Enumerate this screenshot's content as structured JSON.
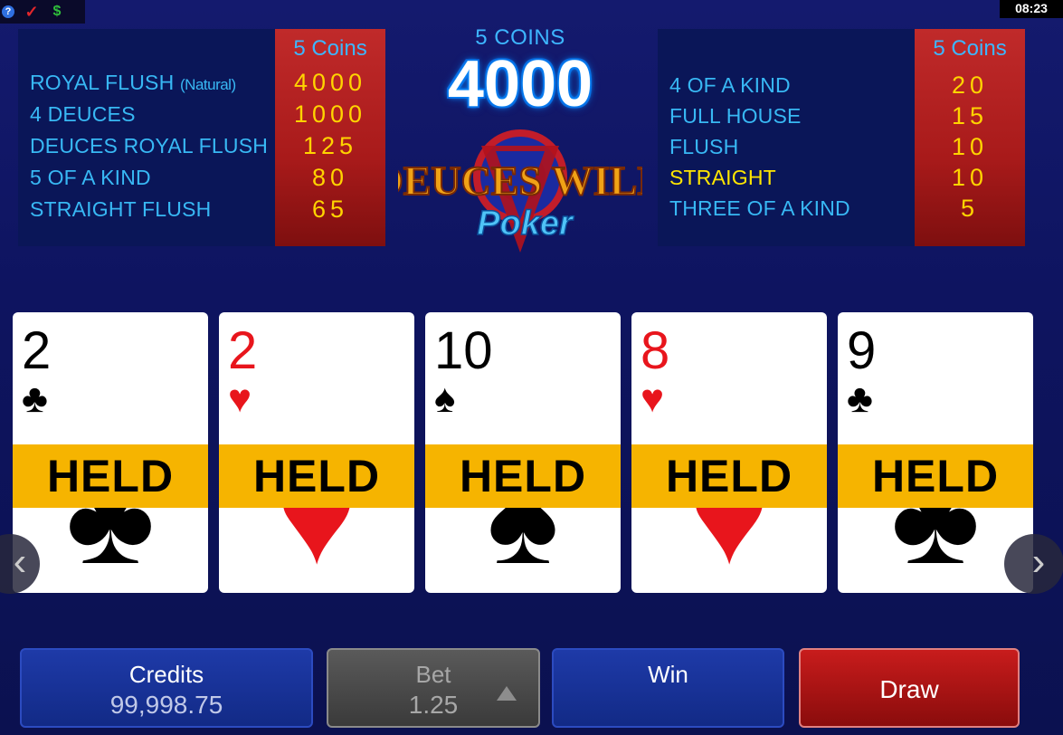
{
  "top_bar": {
    "help_icon_glyph": "?",
    "check_icon_glyph": "✓",
    "dollar_icon_glyph": "$",
    "clock": "08:23"
  },
  "paytable_left": {
    "header": "5 Coins",
    "rows": [
      {
        "name": "ROYAL FLUSH",
        "sub": "(Natural)",
        "value": "4000"
      },
      {
        "name": "4 DEUCES",
        "sub": "",
        "value": "1000"
      },
      {
        "name": "DEUCES ROYAL FLUSH",
        "sub": "",
        "value": "125"
      },
      {
        "name": "5 OF A KIND",
        "sub": "",
        "value": "80"
      },
      {
        "name": "STRAIGHT FLUSH",
        "sub": "",
        "value": "65"
      }
    ]
  },
  "paytable_right": {
    "header": "5 Coins",
    "rows": [
      {
        "name": "4 OF A KIND",
        "value": "20",
        "highlight": false
      },
      {
        "name": "FULL HOUSE",
        "value": "15",
        "highlight": false
      },
      {
        "name": "FLUSH",
        "value": "10",
        "highlight": false
      },
      {
        "name": "STRAIGHT",
        "value": "10",
        "highlight": true
      },
      {
        "name": "THREE OF A KIND",
        "value": "5",
        "highlight": false
      }
    ]
  },
  "center": {
    "coins_label": "5 COINS",
    "jackpot": "4000",
    "logo_line1": "DEUCES WILD",
    "logo_line2": "Poker"
  },
  "cards": [
    {
      "rank": "2",
      "suit": "♣",
      "color": "black",
      "held_label": "HELD"
    },
    {
      "rank": "2",
      "suit": "♥",
      "color": "red",
      "held_label": "HELD"
    },
    {
      "rank": "10",
      "suit": "♠",
      "color": "black",
      "held_label": "HELD"
    },
    {
      "rank": "8",
      "suit": "♥",
      "color": "red",
      "held_label": "HELD"
    },
    {
      "rank": "9",
      "suit": "♣",
      "color": "black",
      "held_label": "HELD"
    }
  ],
  "nav": {
    "left_glyph": "‹",
    "right_glyph": "›"
  },
  "bottom": {
    "credits_label": "Credits",
    "credits_value": "99,998.75",
    "bet_label": "Bet",
    "bet_value": "1.25",
    "win_label": "Win",
    "draw_label": "Draw"
  },
  "colors": {
    "background": "#141a6e",
    "paytable_accent": "#c02a2a",
    "paytable_text": "#38b8f4",
    "payout_text": "#ffd400",
    "held_bar": "#f6b400",
    "draw_button": "#c81c1c"
  }
}
